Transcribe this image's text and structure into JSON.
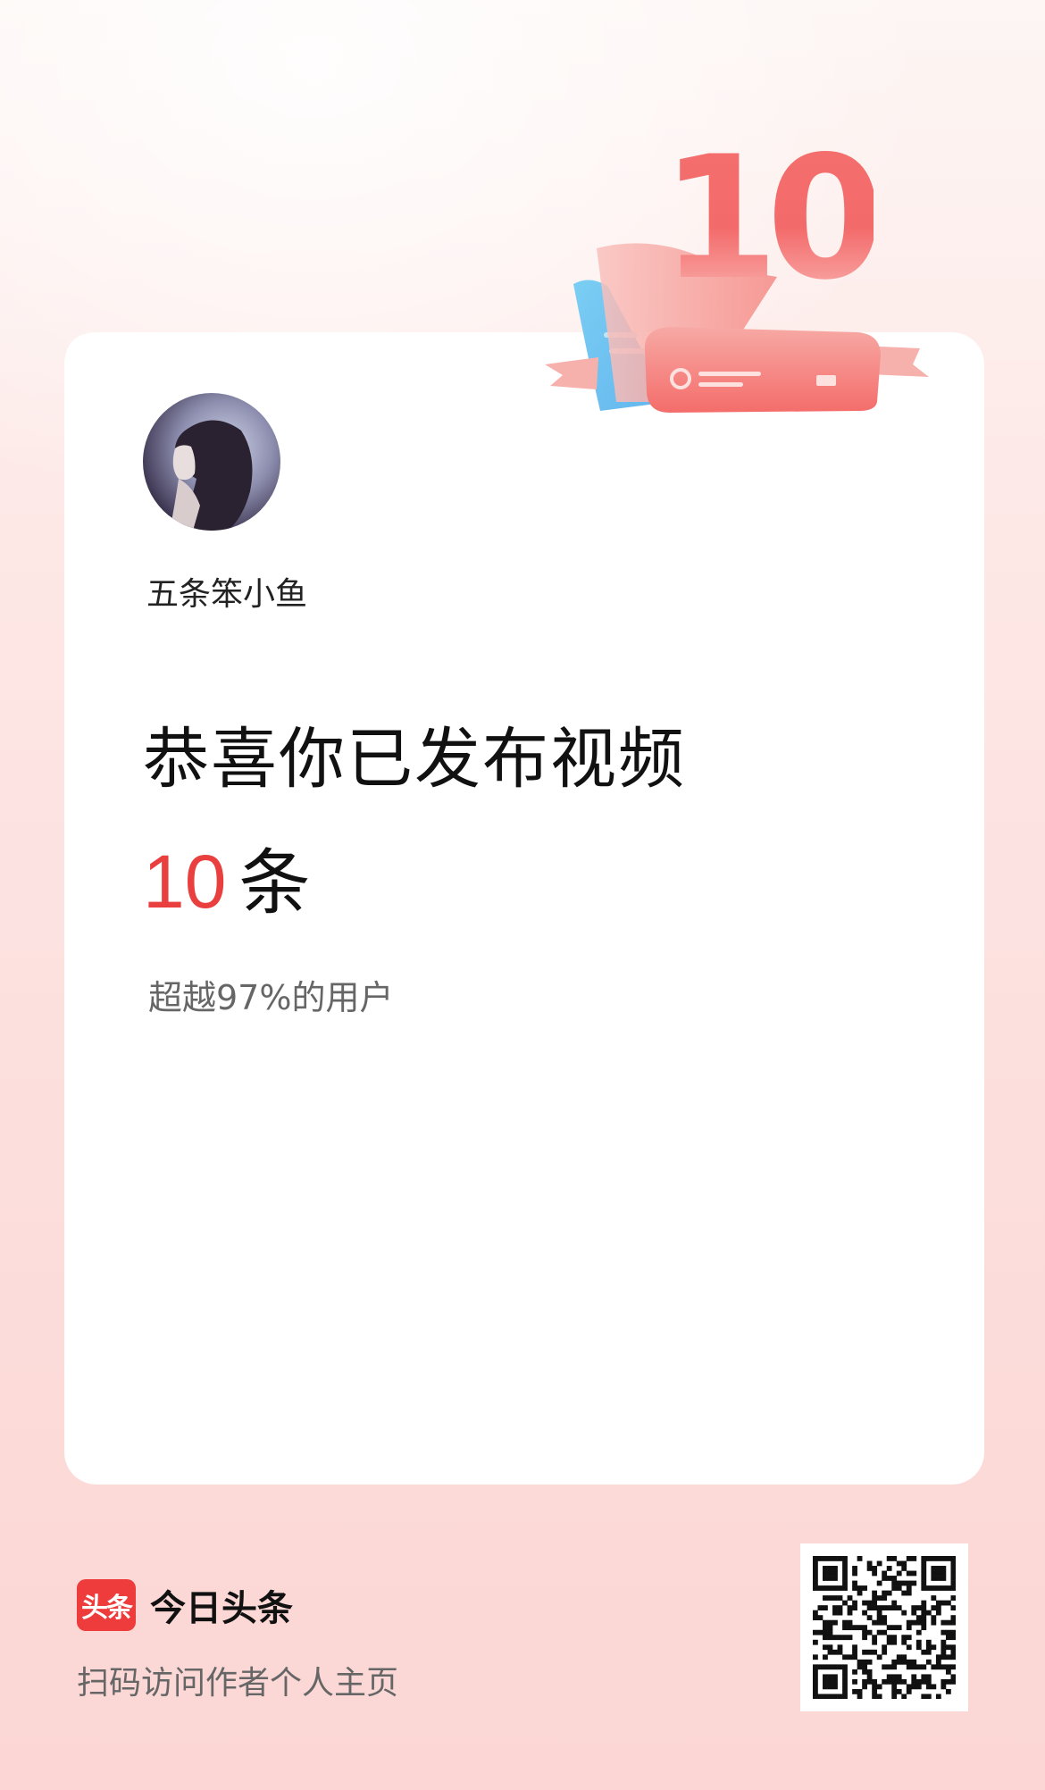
{
  "milestone": {
    "number": "10"
  },
  "user": {
    "name": "五条笨小鱼"
  },
  "headline": "恭喜你已发布视频",
  "count": {
    "value": "10",
    "unit": "条"
  },
  "percentile_text": "超越97%的用户",
  "footer": {
    "brand_logo_text": "头条",
    "brand_name": "今日头条",
    "scan_text": "扫码访问作者个人主页"
  },
  "colors": {
    "accent": "#ea3f3f",
    "card": "#ffffff",
    "background": "#fcdedc",
    "ribbon_blue": "#6cc3ef"
  }
}
